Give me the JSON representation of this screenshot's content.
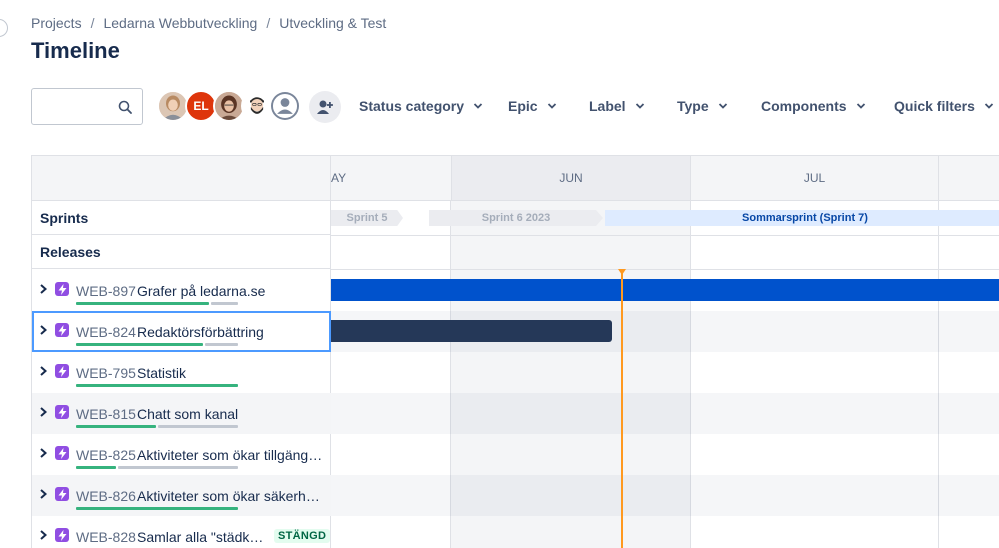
{
  "breadcrumb": {
    "items": [
      "Projects",
      "Ledarna Webbutveckling",
      "Utveckling & Test"
    ],
    "separator": "/"
  },
  "page_title": "Timeline",
  "search": {
    "value": "",
    "placeholder": ""
  },
  "avatars": [
    {
      "type": "photo",
      "icon": "user-photo"
    },
    {
      "type": "initials",
      "text": "EL",
      "color": "#de350b"
    },
    {
      "type": "photo",
      "icon": "user-photo"
    },
    {
      "type": "photo",
      "icon": "user-photo-bearded"
    },
    {
      "type": "placeholder",
      "icon": "user-placeholder-icon"
    }
  ],
  "filters": {
    "status_category": "Status category",
    "epic": "Epic",
    "label": "Label",
    "type": "Type",
    "components": "Components",
    "quick_filters": "Quick filters"
  },
  "timeline": {
    "months": [
      "AY",
      "JUN",
      "JUL"
    ],
    "current_month": "JUN",
    "sprints": [
      "Sprint 5",
      "Sprint 6 2023",
      "Sommarsprint (Sprint 7)"
    ],
    "row_labels": {
      "sprints": "Sprints",
      "releases": "Releases"
    },
    "issues": [
      {
        "key": "WEB-897",
        "summary": "Grafer på ledarna.se",
        "progress_done": 0.83,
        "bar_color": "#0052cc"
      },
      {
        "key": "WEB-824",
        "summary": "Redaktörsförbättring",
        "progress_done": 0.79,
        "bar_color": "#253858"
      },
      {
        "key": "WEB-795",
        "summary": "Statistik",
        "progress_done": 1.0
      },
      {
        "key": "WEB-815",
        "summary": "Chatt som kanal",
        "progress_done": 0.5
      },
      {
        "key": "WEB-825",
        "summary": "Aktiviteter som ökar tillgängli...",
        "progress_done": 0.25
      },
      {
        "key": "WEB-826",
        "summary": "Aktiviteter som ökar säkerhete...",
        "progress_done": 1.0
      },
      {
        "key": "WEB-828",
        "summary": "Samlar alla \"städkort...",
        "status": "STÄNGD"
      }
    ],
    "today_color": "#ff991f"
  }
}
